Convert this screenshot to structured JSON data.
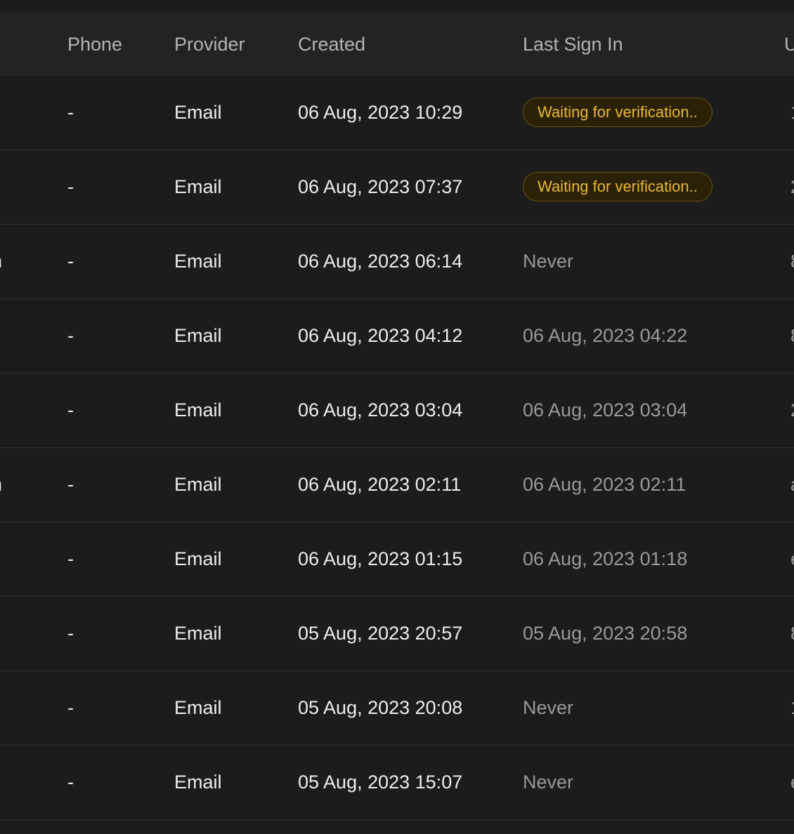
{
  "columns": {
    "phone": "Phone",
    "provider": "Provider",
    "created": "Created",
    "last_sign_in": "Last Sign In",
    "uid_partial": "U"
  },
  "colors": {
    "background": "#1c1c1c",
    "header_bg": "#232323",
    "badge_text": "#e8b931",
    "badge_border": "#6b5510"
  },
  "rows": [
    {
      "email_partial": "",
      "phone": "-",
      "provider": "Email",
      "created": "06 Aug, 2023 10:29",
      "last_sign_in": "Waiting for verification..",
      "status": "waiting",
      "uid_partial": "1"
    },
    {
      "email_partial": "",
      "phone": "-",
      "provider": "Email",
      "created": "06 Aug, 2023 07:37",
      "last_sign_in": "Waiting for verification..",
      "status": "waiting",
      "uid_partial": "2"
    },
    {
      "email_partial": "n",
      "phone": "-",
      "provider": "Email",
      "created": "06 Aug, 2023 06:14",
      "last_sign_in": "Never",
      "status": "never",
      "uid_partial": "8"
    },
    {
      "email_partial": "",
      "phone": "-",
      "provider": "Email",
      "created": "06 Aug, 2023 04:12",
      "last_sign_in": "06 Aug, 2023 04:22",
      "status": "date",
      "uid_partial": "8"
    },
    {
      "email_partial": "",
      "phone": "-",
      "provider": "Email",
      "created": "06 Aug, 2023 03:04",
      "last_sign_in": "06 Aug, 2023 03:04",
      "status": "date",
      "uid_partial": "2"
    },
    {
      "email_partial": "n",
      "phone": "-",
      "provider": "Email",
      "created": "06 Aug, 2023 02:11",
      "last_sign_in": "06 Aug, 2023 02:11",
      "status": "date",
      "uid_partial": "a"
    },
    {
      "email_partial": "",
      "phone": "-",
      "provider": "Email",
      "created": "06 Aug, 2023 01:15",
      "last_sign_in": "06 Aug, 2023 01:18",
      "status": "date",
      "uid_partial": "e"
    },
    {
      "email_partial": "",
      "phone": "-",
      "provider": "Email",
      "created": "05 Aug, 2023 20:57",
      "last_sign_in": "05 Aug, 2023 20:58",
      "status": "date",
      "uid_partial": "8"
    },
    {
      "email_partial": "",
      "phone": "-",
      "provider": "Email",
      "created": "05 Aug, 2023 20:08",
      "last_sign_in": "Never",
      "status": "never",
      "uid_partial": "1"
    },
    {
      "email_partial": "",
      "phone": "-",
      "provider": "Email",
      "created": "05 Aug, 2023 15:07",
      "last_sign_in": "Never",
      "status": "never",
      "uid_partial": "e"
    }
  ]
}
